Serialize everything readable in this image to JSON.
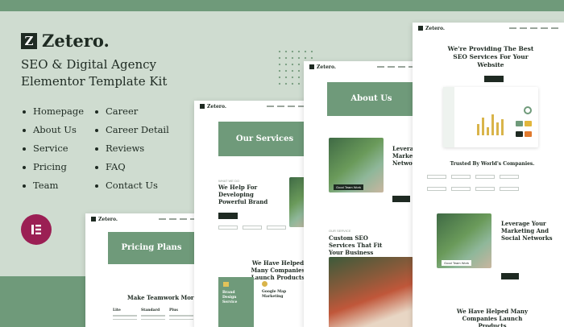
{
  "brand": {
    "name": "Zetero.",
    "mark": "Z"
  },
  "headline": "SEO & Digital Agency Elementor Template Kit",
  "menu_left": [
    "Homepage",
    "About Us",
    "Service",
    "Pricing",
    "Team"
  ],
  "menu_right": [
    "Career",
    "Career Detail",
    "Reviews",
    "FAQ",
    "Contact Us"
  ],
  "badge_icon": "elementor-logo-icon",
  "previews": {
    "pricing": {
      "brand": "Zetero.",
      "banner": "Pricing Plans",
      "heading": "Make Teamwork More Productive",
      "plans": [
        "Lite",
        "Standard",
        "Plus"
      ]
    },
    "services": {
      "brand": "Zetero.",
      "banner": "Our Services",
      "heading": "We Help For Developing Powerful Brand",
      "heading2": "We Have Helped Many Companies Launch Products",
      "box1": "Brand Design Service",
      "box2": "Google Map Marketing"
    },
    "about": {
      "brand": "Zetero.",
      "banner": "About Us",
      "heading": "Leverage Marketing Networks",
      "heading2": "Custom SEO Services That Fit Your Business Needs",
      "tag": "Good Team Work"
    },
    "home": {
      "brand": "Zetero.",
      "hero": "We're Providing The Best SEO Services For Your Website",
      "trusted": "Trusted By World's Companies.",
      "leverage": "Leverage Your Marketing And Social Networks",
      "tag": "Good Team Work",
      "bottom": "We Have Helped Many Companies Launch Products"
    }
  },
  "colors": {
    "background": "#cfdcd0",
    "accent": "#6f9a7a",
    "dark": "#1e2a22",
    "elementor": "#9b1f54"
  }
}
